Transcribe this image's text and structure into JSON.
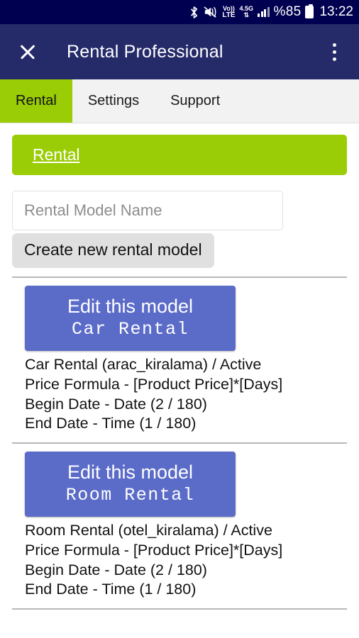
{
  "statusbar": {
    "icons": [
      "bluetooth-icon",
      "mute-icon",
      "volte-icon",
      "network-4.5g-icon",
      "signal-bars-icon",
      "battery-icon"
    ],
    "volte_top": "Vo))",
    "volte_bottom": "LTE",
    "network": "4.5G",
    "battery_text": "%85",
    "time": "13:22"
  },
  "titlebar": {
    "close_label": "close-icon",
    "title": "Rental Professional",
    "menu_label": "more-options"
  },
  "tabs": [
    {
      "label": "Rental",
      "active": true
    },
    {
      "label": "Settings",
      "active": false
    },
    {
      "label": "Support",
      "active": false
    }
  ],
  "banner": {
    "link_label": "Rental"
  },
  "form": {
    "placeholder": "Rental Model Name",
    "value": "",
    "create_button": "Create new rental model"
  },
  "models": [
    {
      "edit_label": "Edit this model",
      "name_mono": "Car Rental",
      "info": [
        "Car Rental (arac_kiralama) / Active",
        "Price Formula - [Product Price]*[Days]",
        "Begin Date - Date (2 / 180)",
        "End Date - Time (1 / 180)"
      ]
    },
    {
      "edit_label": "Edit this model",
      "name_mono": "Room Rental",
      "info": [
        "Room Rental (otel_kiralama) / Active",
        "Price Formula - [Product Price]*[Days]",
        "Begin Date - Date (2 / 180)",
        "End Date - Time (1 / 180)"
      ]
    }
  ],
  "colors": {
    "statusbar_bg": "#000050",
    "titlebar_bg": "#252a69",
    "accent_green": "#9ACD05",
    "button_blue": "#5B6BC8",
    "button_gray": "#e0e0e0"
  }
}
